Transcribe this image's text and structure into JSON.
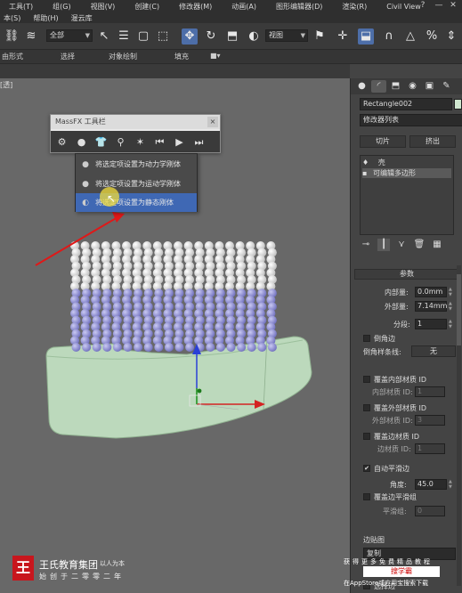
{
  "menubar": {
    "row1": [
      "工具(T)",
      "组(G)",
      "视图(V)",
      "创建(C)",
      "修改器(M)",
      "动画(A)",
      "图形编辑器(D)",
      "渲染(R)",
      "Civil View"
    ],
    "row2": [
      "本(S)",
      "帮助(H)",
      "渥云库"
    ],
    "help_icon": "?",
    "window_controls": [
      "—",
      "□",
      "✕"
    ]
  },
  "toolbar": {
    "selection_filter": "全部",
    "reference_coord": "视图",
    "icons": [
      "snap-link-icon",
      "bind-spacewarp-icon",
      "select-object-icon",
      "select-by-name-icon",
      "rect-region-icon",
      "window-crossing-icon",
      "move-icon",
      "rotate-icon",
      "scale-icon",
      "pivot-icon",
      "select-manipulate-icon",
      "keyboard-shortcut-icon",
      "snap-3d-icon",
      "angle-snap-icon",
      "percent-snap-icon",
      "spinner-snap-icon"
    ]
  },
  "ribbon": {
    "items": [
      "由形式",
      "选择",
      "对象绘制",
      "填充"
    ]
  },
  "viewport": {
    "label": "[透]"
  },
  "massfx": {
    "title": "MassFX 工具栏",
    "close": "×",
    "menu_items": [
      {
        "label": "将选定项设置为动力学刚体",
        "icon": "dynamic-rigid-body-icon",
        "highlighted": false
      },
      {
        "label": "将选定项设置为运动学刚体",
        "icon": "kinematic-rigid-body-icon",
        "highlighted": false
      },
      {
        "label": "将选定项设置为静态刚体",
        "icon": "static-rigid-body-icon",
        "highlighted": true
      }
    ]
  },
  "command_panel": {
    "object_name": "Rectangle002",
    "modifier_list": "修改器列表",
    "buttons": [
      "切片",
      "挤出"
    ],
    "stack": [
      {
        "label": "壳",
        "selected": false
      },
      {
        "label": "可编辑多边形",
        "selected": true
      }
    ],
    "params_title": "参数",
    "inner_amount_label": "内部量:",
    "inner_amount_value": "0.0mm",
    "outer_amount_label": "外部量:",
    "outer_amount_value": "7.14mm",
    "segments_label": "分段:",
    "segments_value": "1",
    "bevel_edges_label": "倒角边",
    "bevel_spline_label": "倒角样条线:",
    "bevel_spline_value": "无",
    "override_inner_mat_label": "覆盖内部材质 ID",
    "inner_mat_label": "内部材质 ID:",
    "inner_mat_value": "1",
    "override_outer_mat_label": "覆盖外部材质 ID",
    "outer_mat_label": "外部材质 ID:",
    "outer_mat_value": "3",
    "override_edge_mat_label": "覆盖边材质 ID",
    "edge_mat_label": "边材质 ID:",
    "edge_mat_value": "1",
    "auto_smooth_label": "自动平滑边",
    "auto_smooth_checked": true,
    "angle_label": "角度:",
    "angle_value": "45.0",
    "override_smooth_label": "覆盖边平滑组",
    "smooth_group_label": "平滑组:",
    "smooth_group_value": "0",
    "edge_map_label": "边贴图",
    "edge_map_value": "复制",
    "select_edge_label": "选择边"
  },
  "watermarks": {
    "brand_logo": "王",
    "brand_name": "王氏教育集团",
    "brand_slogan": "以人为本",
    "brand_date": "始创于二零零二年",
    "appstore_line1": "获得更多免费精品教程",
    "appstore_mid": "搜学霸",
    "appstore_line3": "在AppStore或应用宝搜索下载"
  }
}
